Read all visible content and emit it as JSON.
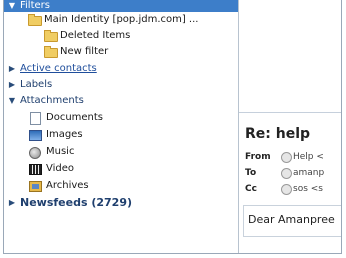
{
  "sidebar": {
    "filters_label": "Filters",
    "identity_label": "Main Identity [pop.jdm.com] ...",
    "deleted_label": "Deleted Items",
    "new_filter_label": "New filter",
    "active_contacts_label": "Active contacts",
    "labels_label": "Labels",
    "attachments_label": "Attachments",
    "documents_label": "Documents",
    "images_label": "Images",
    "music_label": "Music",
    "video_label": "Video",
    "archives_label": "Archives",
    "newsfeeds_label": "Newsfeeds (2729)",
    "icons": [
      "folder-icon",
      "document-icon",
      "image-icon",
      "music-icon",
      "video-icon",
      "archive-icon"
    ]
  },
  "message": {
    "subject": "Re: help",
    "from_key": "From",
    "from_value": "Help <",
    "to_key": "To",
    "to_value": "amanp",
    "cc_key": "Cc",
    "cc_value": "sos <s",
    "body_snippet": "Dear Amanpree"
  },
  "colors": {
    "selection": "#3d7ec9",
    "link": "#1f4e9c",
    "folder": "#f0cd63"
  }
}
